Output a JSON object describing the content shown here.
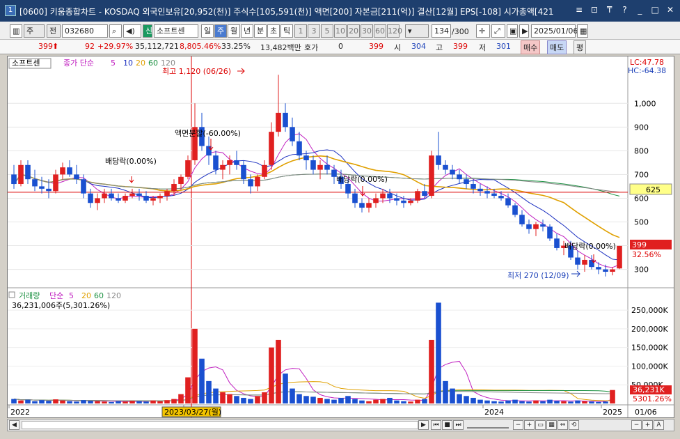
{
  "window": {
    "number": "1",
    "title": "[0600] 키움종합차트 - KOSDAQ 외국인보유[20,952(천)] 주식수[105,591(천)] 액면[200] 자본금[211(억)] 결산[12월] EPS[-108] 시가총액[421",
    "buttons": [
      "≡",
      "⊡",
      "₸",
      "?",
      "_",
      "□",
      "✕"
    ]
  },
  "toolbar": {
    "mode": "주",
    "view": "전",
    "code": "032680",
    "badge": "신",
    "stock_name": "소프트센",
    "periods": [
      "일",
      "주",
      "월",
      "년",
      "분",
      "초",
      "틱"
    ],
    "active_period": "주",
    "intervals": [
      "1",
      "3",
      "5",
      "10",
      "20",
      "30",
      "60",
      "120"
    ],
    "count": "134",
    "count_total": "/300",
    "date": "2025/01/06"
  },
  "quote": {
    "price": "399",
    "change": "92",
    "change_pct": "+29.97%",
    "volume": "35,112,721",
    "vol_pct": "8,805.46%",
    "turnover": "33.25%",
    "amount": "13,482백만",
    "hoga_label": "호가",
    "hoga": "0",
    "hoga_price": "399",
    "open_label": "시",
    "open": "304",
    "high_label": "고",
    "high": "399",
    "low_label": "저",
    "low": "301",
    "buy": "매수",
    "sell": "매도",
    "avg": "평"
  },
  "price_panel": {
    "legend_name": "소프트센",
    "legend_ma": "종가 단순",
    "ma_periods": [
      "5",
      "10",
      "20",
      "60",
      "120"
    ],
    "ma_colors": [
      "#c020c0",
      "#1a2fc0",
      "#e0a000",
      "#1a9040",
      "#888888"
    ],
    "lc": "LC:47.78",
    "hc": "HC:-64.38",
    "high_note": "최고 1,120 (06/26)",
    "low_note": "최저 270 (12/09)",
    "cur_price": "399",
    "cur_pct": "32.56%",
    "line_price": "625",
    "annotations": [
      "배당락(0.00%)",
      "액면분할(-60.00%)",
      "배당락(0.00%)",
      "배당락(0.00%)"
    ],
    "yticks": [
      "1,000",
      "900",
      "800",
      "700",
      "600",
      "500",
      "400",
      "300"
    ]
  },
  "volume_panel": {
    "legend_name": "거래량",
    "legend_ma": "단순",
    "ma_periods": [
      "5",
      "20",
      "60",
      "120"
    ],
    "value_text": "36,231,006주(5,301.26%)",
    "cur_vol": "36,231K",
    "cur_pct": "5301.26%",
    "yticks": [
      "250,000K",
      "200,000K",
      "150,000K",
      "100,000K",
      "50,000K"
    ]
  },
  "xaxis": {
    "labels": [
      "2022",
      "2023",
      "2024",
      "2025"
    ],
    "cursor_label": "2023/03/27(월)",
    "right_label": "01/06"
  },
  "chart_data": {
    "type": "candlestick",
    "y_range": [
      240,
      1180
    ],
    "ref_line": 625,
    "ohlc": [
      [
        700,
        740,
        640,
        660
      ],
      [
        660,
        760,
        650,
        740
      ],
      [
        740,
        760,
        660,
        680
      ],
      [
        680,
        720,
        630,
        650
      ],
      [
        650,
        690,
        620,
        640
      ],
      [
        640,
        680,
        600,
        630
      ],
      [
        630,
        720,
        620,
        700
      ],
      [
        700,
        750,
        680,
        730
      ],
      [
        730,
        760,
        690,
        700
      ],
      [
        700,
        740,
        660,
        680
      ],
      [
        680,
        700,
        600,
        620
      ],
      [
        620,
        640,
        560,
        580
      ],
      [
        580,
        620,
        550,
        600
      ],
      [
        600,
        640,
        580,
        620
      ],
      [
        620,
        640,
        590,
        600
      ],
      [
        600,
        620,
        580,
        590
      ],
      [
        590,
        620,
        580,
        610
      ],
      [
        610,
        640,
        600,
        620
      ],
      [
        620,
        640,
        590,
        610
      ],
      [
        610,
        630,
        580,
        590
      ],
      [
        590,
        610,
        570,
        600
      ],
      [
        600,
        620,
        580,
        610
      ],
      [
        610,
        640,
        590,
        630
      ],
      [
        630,
        680,
        610,
        660
      ],
      [
        660,
        700,
        640,
        690
      ],
      [
        690,
        780,
        680,
        760
      ],
      [
        760,
        1000,
        740,
        900
      ],
      [
        900,
        960,
        800,
        820
      ],
      [
        820,
        860,
        740,
        780
      ],
      [
        780,
        800,
        700,
        720
      ],
      [
        720,
        760,
        680,
        740
      ],
      [
        740,
        780,
        700,
        760
      ],
      [
        760,
        800,
        720,
        740
      ],
      [
        740,
        760,
        660,
        680
      ],
      [
        680,
        700,
        620,
        650
      ],
      [
        650,
        700,
        630,
        690
      ],
      [
        690,
        760,
        680,
        740
      ],
      [
        740,
        920,
        720,
        880
      ],
      [
        880,
        1120,
        860,
        960
      ],
      [
        960,
        1000,
        880,
        900
      ],
      [
        900,
        940,
        820,
        840
      ],
      [
        840,
        880,
        760,
        780
      ],
      [
        780,
        800,
        720,
        760
      ],
      [
        760,
        780,
        700,
        720
      ],
      [
        720,
        760,
        680,
        740
      ],
      [
        740,
        780,
        700,
        720
      ],
      [
        720,
        740,
        660,
        690
      ],
      [
        690,
        720,
        640,
        660
      ],
      [
        660,
        680,
        600,
        620
      ],
      [
        620,
        640,
        560,
        580
      ],
      [
        580,
        600,
        540,
        560
      ],
      [
        560,
        600,
        540,
        580
      ],
      [
        580,
        620,
        560,
        600
      ],
      [
        600,
        640,
        580,
        620
      ],
      [
        620,
        640,
        580,
        600
      ],
      [
        600,
        620,
        570,
        590
      ],
      [
        590,
        610,
        560,
        580
      ],
      [
        580,
        600,
        570,
        590
      ],
      [
        590,
        640,
        580,
        630
      ],
      [
        630,
        660,
        600,
        610
      ],
      [
        610,
        800,
        600,
        780
      ],
      [
        780,
        880,
        720,
        740
      ],
      [
        740,
        760,
        700,
        720
      ],
      [
        720,
        740,
        680,
        700
      ],
      [
        700,
        720,
        660,
        680
      ],
      [
        680,
        700,
        640,
        660
      ],
      [
        660,
        680,
        620,
        640
      ],
      [
        640,
        660,
        610,
        630
      ],
      [
        630,
        650,
        600,
        620
      ],
      [
        620,
        640,
        600,
        610
      ],
      [
        610,
        630,
        590,
        600
      ],
      [
        600,
        620,
        560,
        570
      ],
      [
        570,
        580,
        520,
        530
      ],
      [
        530,
        550,
        480,
        490
      ],
      [
        490,
        510,
        450,
        470
      ],
      [
        470,
        500,
        440,
        490
      ],
      [
        490,
        510,
        460,
        480
      ],
      [
        480,
        490,
        420,
        430
      ],
      [
        430,
        450,
        380,
        390
      ],
      [
        390,
        420,
        360,
        400
      ],
      [
        400,
        420,
        340,
        350
      ],
      [
        350,
        380,
        300,
        320
      ],
      [
        320,
        360,
        290,
        340
      ],
      [
        340,
        360,
        300,
        310
      ],
      [
        310,
        330,
        280,
        300
      ],
      [
        300,
        320,
        270,
        290
      ],
      [
        290,
        310,
        275,
        300
      ],
      [
        304,
        399,
        301,
        399
      ]
    ],
    "volume_k": [
      12,
      8,
      10,
      6,
      9,
      7,
      11,
      8,
      6,
      5,
      9,
      7,
      6,
      5,
      4,
      6,
      5,
      7,
      6,
      5,
      8,
      6,
      9,
      12,
      25,
      70,
      200,
      120,
      60,
      40,
      30,
      25,
      20,
      15,
      12,
      20,
      30,
      150,
      170,
      80,
      40,
      25,
      20,
      18,
      15,
      12,
      10,
      15,
      20,
      12,
      8,
      6,
      10,
      12,
      15,
      8,
      6,
      5,
      10,
      12,
      170,
      270,
      60,
      40,
      25,
      20,
      15,
      10,
      8,
      6,
      5,
      8,
      10,
      6,
      5,
      8,
      6,
      10,
      7,
      6,
      5,
      8,
      6,
      5,
      4,
      5,
      36
    ]
  }
}
